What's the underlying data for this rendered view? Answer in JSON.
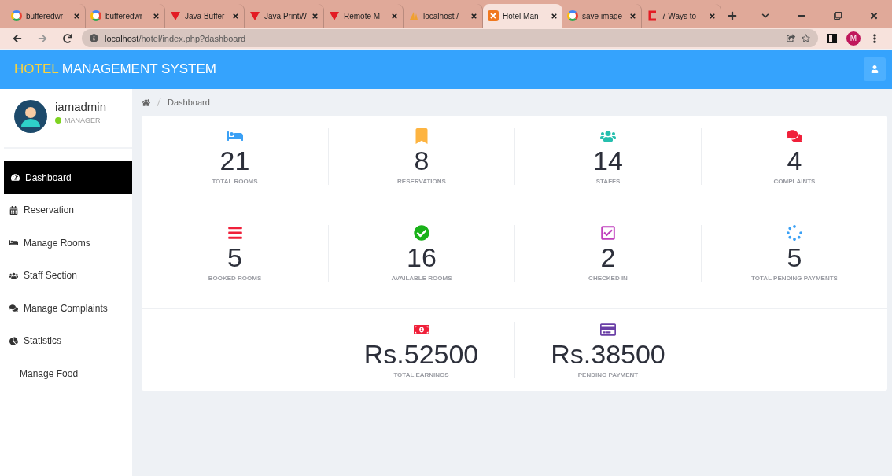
{
  "browser": {
    "tabs": [
      {
        "kind": "google",
        "title": "bufferedwr",
        "selected": false
      },
      {
        "kind": "google",
        "title": "bufferedwr",
        "selected": false
      },
      {
        "kind": "triangle",
        "title": "Java Buffer",
        "selected": false
      },
      {
        "kind": "triangle",
        "title": "Java PrintW",
        "selected": false
      },
      {
        "kind": "triangle",
        "title": "Remote M",
        "selected": false
      },
      {
        "kind": "pma",
        "title": "localhost /",
        "selected": false
      },
      {
        "kind": "xampp",
        "title": "Hotel Man",
        "selected": true
      },
      {
        "kind": "google",
        "title": "save image",
        "selected": false
      },
      {
        "kind": "c",
        "title": "7 Ways to",
        "selected": false
      }
    ],
    "url_host": "localhost",
    "url_path": "/hotel/index.php?dashboard",
    "profile": "M"
  },
  "header": {
    "brand_accent": "HOTEL",
    "brand_rest": "MANAGEMENT SYSTEM"
  },
  "user": {
    "name": "iamadmin",
    "role": "MANAGER"
  },
  "sidebar": {
    "items": [
      {
        "kind": "dashboard",
        "label": "Dashboard",
        "selected": true
      },
      {
        "kind": "calendar",
        "label": "Reservation",
        "selected": false
      },
      {
        "kind": "bed",
        "label": "Manage Rooms",
        "selected": false
      },
      {
        "kind": "users",
        "label": "Staff Section",
        "selected": false
      },
      {
        "kind": "comments",
        "label": "Manage Complaints",
        "selected": false
      },
      {
        "kind": "pie",
        "label": "Statistics",
        "selected": false
      },
      {
        "kind": "plain",
        "label": "Manage Food",
        "selected": false
      }
    ]
  },
  "breadcrumb": "Dashboard",
  "stat_rows": [
    [
      {
        "kind": "bed",
        "color": "#3aa0f5",
        "value": "21",
        "label": "TOTAL ROOMS"
      },
      {
        "kind": "bookmark",
        "color": "#fdb441",
        "value": "8",
        "label": "RESERVATIONS"
      },
      {
        "kind": "users",
        "color": "#26bfae",
        "value": "14",
        "label": "STAFFS"
      },
      {
        "kind": "comments",
        "color": "#f0203a",
        "value": "4",
        "label": "COMPLAINTS"
      }
    ],
    [
      {
        "kind": "bars",
        "color": "#f0203a",
        "value": "5",
        "label": "BOOKED ROOMS"
      },
      {
        "kind": "check-circle",
        "color": "#1ab21a",
        "value": "16",
        "label": "AVAILABLE ROOMS"
      },
      {
        "kind": "check-square",
        "color": "#c03fbd",
        "value": "2",
        "label": "CHECKED IN"
      },
      {
        "kind": "spinner",
        "color": "#3aa0f5",
        "value": "5",
        "label": "TOTAL PENDING PAYMENTS"
      }
    ],
    [
      {
        "kind": "money",
        "color": "#f0203a",
        "value": "Rs.52500",
        "label": "TOTAL EARNINGS"
      },
      {
        "kind": "card",
        "color": "#6a3fa6",
        "value": "Rs.38500",
        "label": "PENDING PAYMENT"
      }
    ]
  ]
}
